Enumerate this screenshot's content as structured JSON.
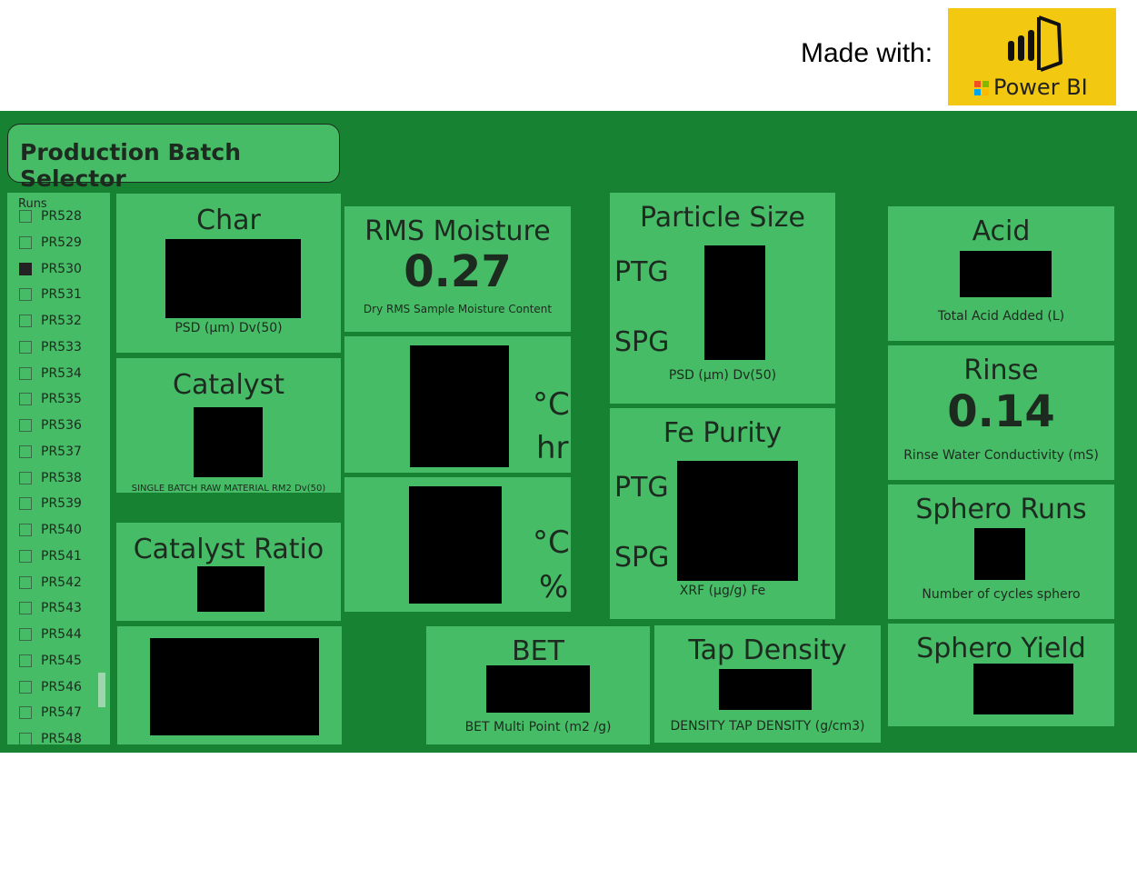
{
  "header": {
    "made_with": "Made with:",
    "logo_text": "Power BI"
  },
  "colors": {
    "dashboard_bg": "#178231",
    "card_bg": "#46bc66",
    "logo_bg": "#f2c811"
  },
  "selector": {
    "title": "Production Batch Selector"
  },
  "slicer": {
    "header": "Runs",
    "items": [
      {
        "label": "PR528",
        "checked": false
      },
      {
        "label": "PR529",
        "checked": false
      },
      {
        "label": "PR530",
        "checked": true
      },
      {
        "label": "PR531",
        "checked": false
      },
      {
        "label": "PR532",
        "checked": false
      },
      {
        "label": "PR533",
        "checked": false
      },
      {
        "label": "PR534",
        "checked": false
      },
      {
        "label": "PR535",
        "checked": false
      },
      {
        "label": "PR536",
        "checked": false
      },
      {
        "label": "PR537",
        "checked": false
      },
      {
        "label": "PR538",
        "checked": false
      },
      {
        "label": "PR539",
        "checked": false
      },
      {
        "label": "PR540",
        "checked": false
      },
      {
        "label": "PR541",
        "checked": false
      },
      {
        "label": "PR542",
        "checked": false
      },
      {
        "label": "PR543",
        "checked": false
      },
      {
        "label": "PR544",
        "checked": false
      },
      {
        "label": "PR545",
        "checked": false
      },
      {
        "label": "PR546",
        "checked": false
      },
      {
        "label": "PR547",
        "checked": false
      },
      {
        "label": "PR548",
        "checked": false
      }
    ]
  },
  "cards": {
    "char": {
      "title": "Char",
      "subtitle": "PSD (μm) Dv(50)"
    },
    "catalyst": {
      "title": "Catalyst",
      "subtitle": "SINGLE BATCH RAW MATERIAL RM2  Dv(50)"
    },
    "catalyst_ratio": {
      "title": "Catalyst Ratio"
    },
    "rms_moisture": {
      "title": "RMS Moisture",
      "value": "0.27",
      "subtitle": "Dry RMS Sample Moisture Content"
    },
    "temp_time": {
      "unit1": "°C",
      "unit2": "hr"
    },
    "temp_pct": {
      "unit1": "°C",
      "unit2": "%"
    },
    "particle_size": {
      "title": "Particle Size",
      "label1": "PTG",
      "label2": "SPG",
      "subtitle": "PSD (μm) Dv(50)"
    },
    "fe_purity": {
      "title": "Fe Purity",
      "label1": "PTG",
      "label2": "SPG",
      "subtitle": "XRF (μg/g) Fe"
    },
    "bet": {
      "title": "BET",
      "subtitle": "BET  Multi Point  (m2 /g)"
    },
    "tap_density": {
      "title": "Tap Density",
      "subtitle": "DENSITY TAP DENSITY (g/cm3)"
    },
    "acid": {
      "title": "Acid",
      "subtitle": "Total Acid Added (L)"
    },
    "rinse": {
      "title": "Rinse",
      "value": "0.14",
      "subtitle": "Rinse Water Conductivity (mS)"
    },
    "sphero_runs": {
      "title": "Sphero Runs",
      "subtitle": "Number of cycles sphero"
    },
    "sphero_yield": {
      "title": "Sphero Yield"
    }
  }
}
